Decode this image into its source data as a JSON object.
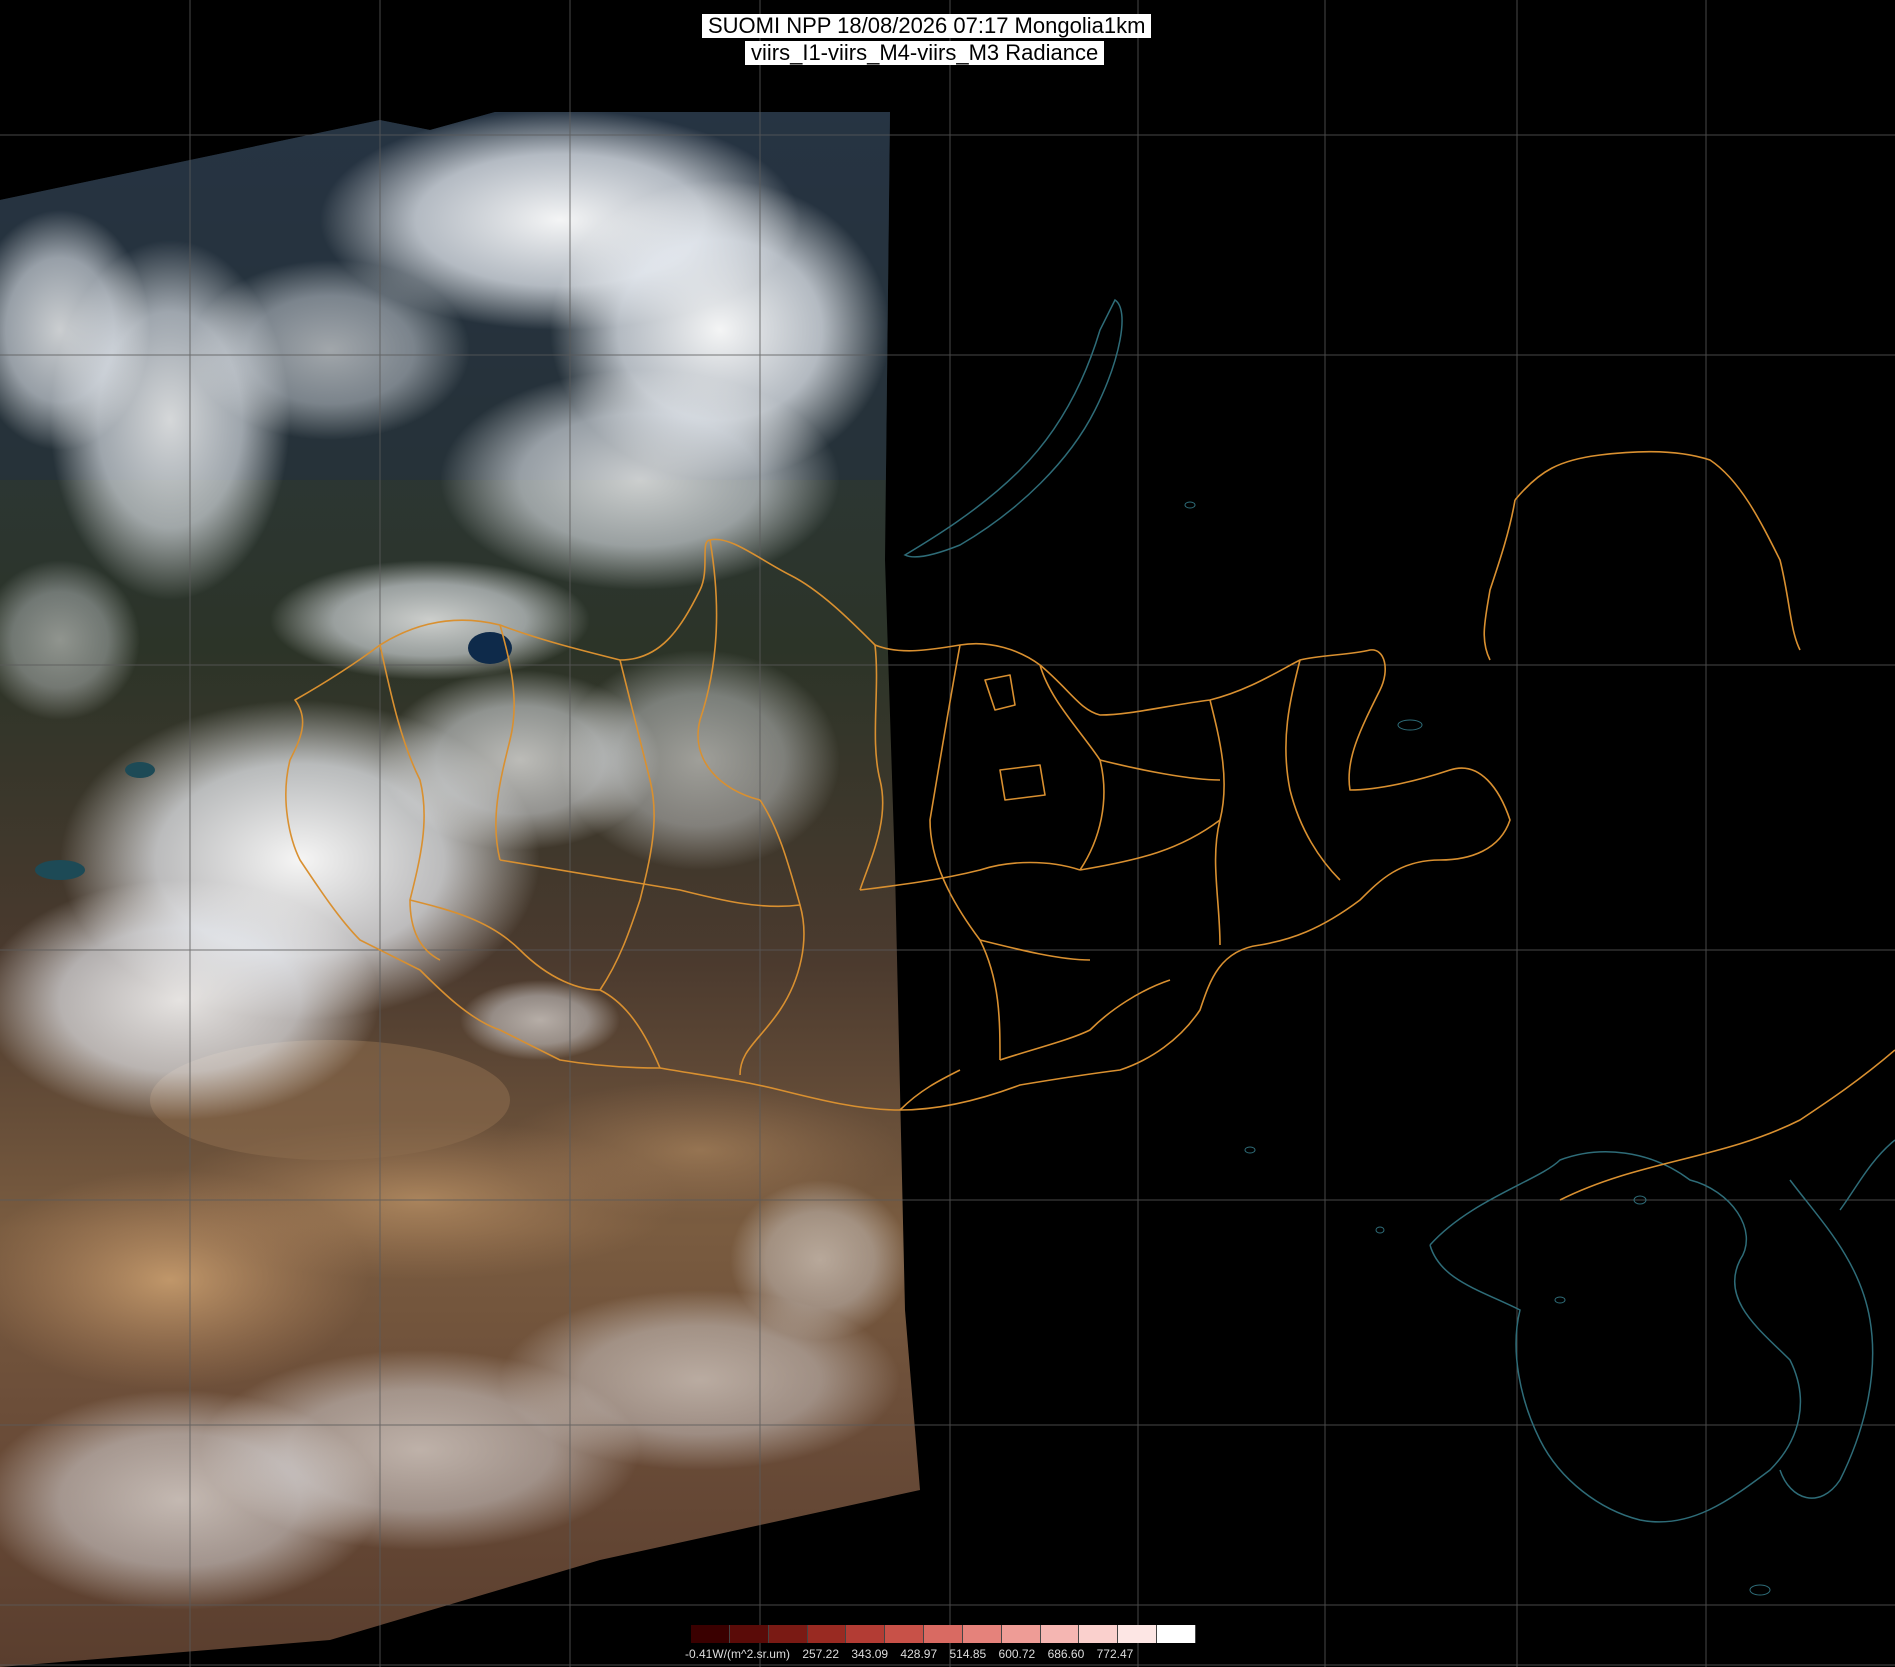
{
  "title": {
    "line1": "SUOMI NPP 18/08/2026 07:17 Mongolia1km",
    "line2": "viirs_I1-viirs_M4-viirs_M3 Radiance"
  },
  "legend": {
    "unit_label": "-0.41W/(m^2.sr.um)",
    "ticks": [
      "257.22",
      "343.09",
      "428.97",
      "514.85",
      "600.72",
      "686.60",
      "772.47"
    ],
    "colors": [
      "#3a0000",
      "#5a0b08",
      "#7a1a14",
      "#992a22",
      "#b33c34",
      "#c85148",
      "#d96a62",
      "#e5827b",
      "#ee9c96",
      "#f5b6b2",
      "#fad0cd",
      "#fde6e4",
      "#ffffff"
    ]
  },
  "colors": {
    "border": "#d99030",
    "coastline": "#2e6c78",
    "grid": "#5a5a5a",
    "background": "#000000"
  }
}
